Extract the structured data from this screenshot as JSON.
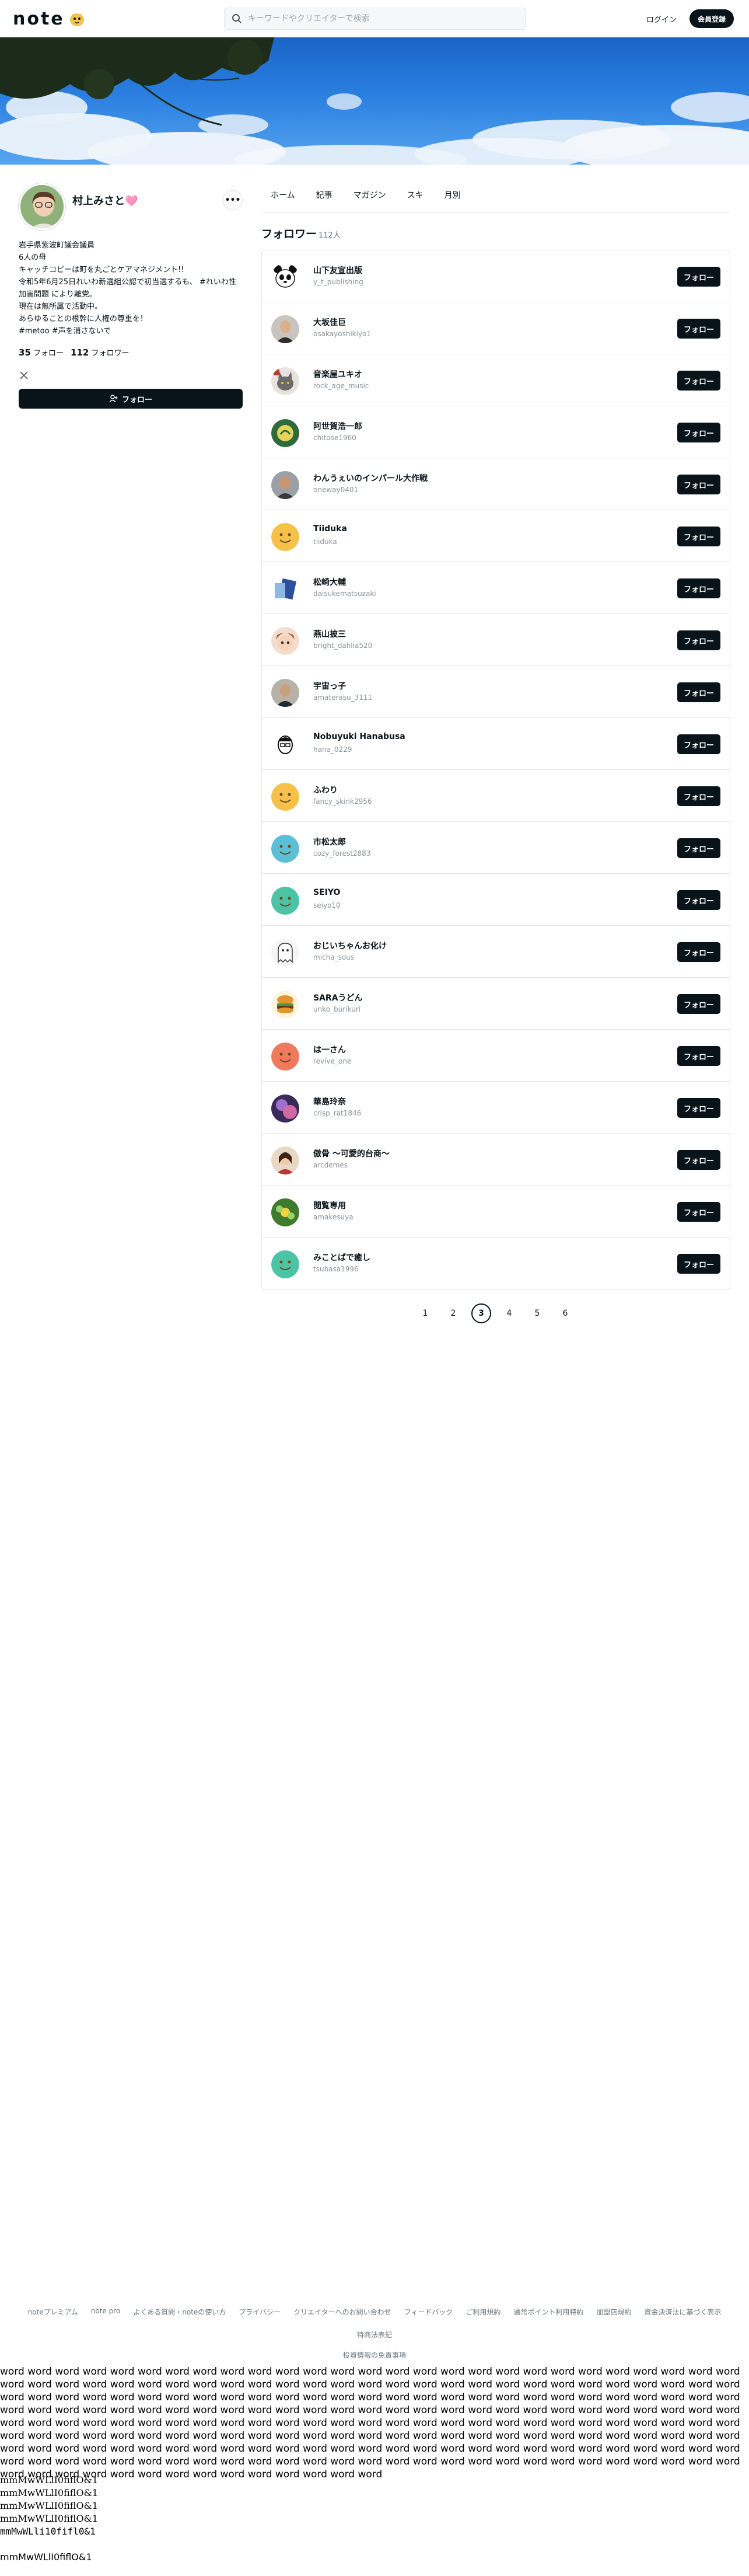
{
  "header": {
    "logo_text": "note",
    "search_placeholder": "キーワードやクリエイターで検索",
    "login_label": "ログイン",
    "signup_label": "会員登録"
  },
  "profile": {
    "name": "村上みさと🩷",
    "more_label": "•••",
    "bio": [
      "岩手県紫波町議会議員",
      "6人の母",
      "キャッチコピーは町を丸ごとケアマネジメント!!",
      "令和5年6月25日れいわ新選組公認で初当選するも、 #れいわ性加害問題 により離党。",
      "現在は無所属で活動中。",
      "あらゆることの根幹に人権の尊重を！",
      "#metoo #声を消さないで"
    ],
    "following_count": "35",
    "following_label": "フォロー",
    "followers_count": "112",
    "followers_label": "フォロワー",
    "follow_button": "フォロー"
  },
  "tabs": [
    "ホーム",
    "記事",
    "マガジン",
    "スキ",
    "月別"
  ],
  "section": {
    "title": "フォロワー",
    "count": "112人"
  },
  "followers": [
    {
      "name": "山下友宣出版",
      "handle": "y_t_publishing",
      "button": "フォロー",
      "avatar": "panda"
    },
    {
      "name": "大坂佳巨",
      "handle": "osakayoshikiyo1",
      "button": "フォロー",
      "avatar": "photo-man"
    },
    {
      "name": "音楽屋ユキオ",
      "handle": "rock_age_music",
      "button": "フォロー",
      "avatar": "cat"
    },
    {
      "name": "阿世賀浩一郎",
      "handle": "chitose1960",
      "button": "フォロー",
      "avatar": "logo-green"
    },
    {
      "name": "わんうぇいのインパール大作戦",
      "handle": "oneway0401",
      "button": "フォロー",
      "avatar": "photo-man2"
    },
    {
      "name": "Tiiduka",
      "handle": "tiiduka",
      "button": "フォロー",
      "avatar": "smile-yellow"
    },
    {
      "name": "松崎大輔",
      "handle": "daisukematsuzaki",
      "button": "フォロー",
      "avatar": "book"
    },
    {
      "name": "燕山披三",
      "handle": "bright_dahlia520",
      "button": "フォロー",
      "avatar": "anime"
    },
    {
      "name": "宇宙っ子",
      "handle": "amaterasu_3111",
      "button": "フォロー",
      "avatar": "photo-man3"
    },
    {
      "name": "Nobuyuki Hanabusa",
      "handle": "hana_0229",
      "button": "フォロー",
      "avatar": "sketch"
    },
    {
      "name": "ふわり",
      "handle": "fancy_skink2956",
      "button": "フォロー",
      "avatar": "smile-yellow"
    },
    {
      "name": "市松太郎",
      "handle": "cozy_forest2883",
      "button": "フォロー",
      "avatar": "smile-blue"
    },
    {
      "name": "SEIYO",
      "handle": "seiyo10",
      "button": "フォロー",
      "avatar": "smile-teal"
    },
    {
      "name": "おじいちゃんお化け",
      "handle": "micha_sous",
      "button": "フォロー",
      "avatar": "ghost"
    },
    {
      "name": "SARAうどん",
      "handle": "unko_burikuri",
      "button": "フォロー",
      "avatar": "burger"
    },
    {
      "name": "は一さん",
      "handle": "revive_one",
      "button": "フォロー",
      "avatar": "smile-red"
    },
    {
      "name": "華島玲奈",
      "handle": "crisp_rat1846",
      "button": "フォロー",
      "avatar": "purple"
    },
    {
      "name": "傲骨 ～可愛的台商～",
      "handle": "arcdemes",
      "button": "フォロー",
      "avatar": "photo-woman"
    },
    {
      "name": "閲覧専用",
      "handle": "amakesuya",
      "button": "フォロー",
      "avatar": "flower"
    },
    {
      "name": "みことばで癒し",
      "handle": "tsubasa1996",
      "button": "フォロー",
      "avatar": "smile-teal"
    }
  ],
  "pagination": {
    "pages": [
      "1",
      "2",
      "3",
      "4",
      "5",
      "6"
    ],
    "current": "3"
  },
  "footer": {
    "links": [
      "noteプレミアム",
      "note pro",
      "よくある質問・noteの使い方",
      "プライバシー",
      "クリエイターへのお問い合わせ",
      "フィードバック",
      "ご利用規約",
      "通常ポイント利用特約",
      "加盟店規約",
      "資金決済法に基づく表示",
      "特商法表記"
    ],
    "last_link": "投資情報の免責事項"
  },
  "filler": {
    "word": "word",
    "mono_lines": [
      "mmMwWLlI0fiflO&1",
      "mmMwWLlI0fiflO&1",
      "mmMwWLlI0fiflO&1",
      "mmMwWLlI0fiflO&1",
      "mmMwWLli10fifl0&1",
      "mmMwWLlI0fiflO&1"
    ]
  },
  "colors": {
    "accent": "#08131a",
    "link_gray": "#6b747a",
    "banner_sky": "#2a7fe0"
  }
}
